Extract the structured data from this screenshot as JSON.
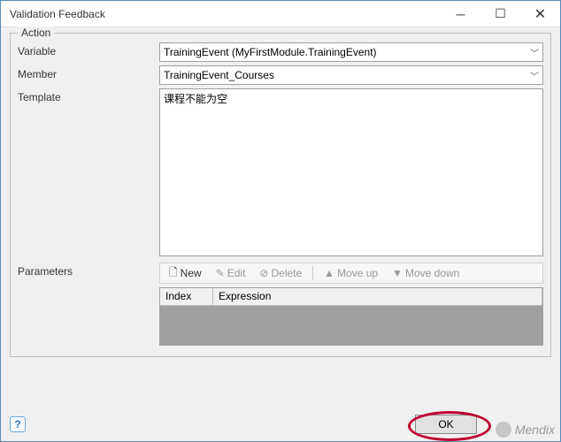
{
  "window": {
    "title": "Validation Feedback"
  },
  "group": {
    "title": "Action",
    "variable_label": "Variable",
    "variable_value": "TrainingEvent (MyFirstModule.TrainingEvent)",
    "member_label": "Member",
    "member_value": "TrainingEvent_Courses",
    "template_label": "Template",
    "template_value": "课程不能为空",
    "parameters_label": "Parameters"
  },
  "toolbar": {
    "new_label": "New",
    "edit_label": "Edit",
    "delete_label": "Delete",
    "moveup_label": "Move up",
    "movedown_label": "Move down"
  },
  "grid": {
    "col_index": "Index",
    "col_expression": "Expression"
  },
  "footer": {
    "ok_label": "OK"
  },
  "watermark": {
    "text": "Mendix"
  }
}
